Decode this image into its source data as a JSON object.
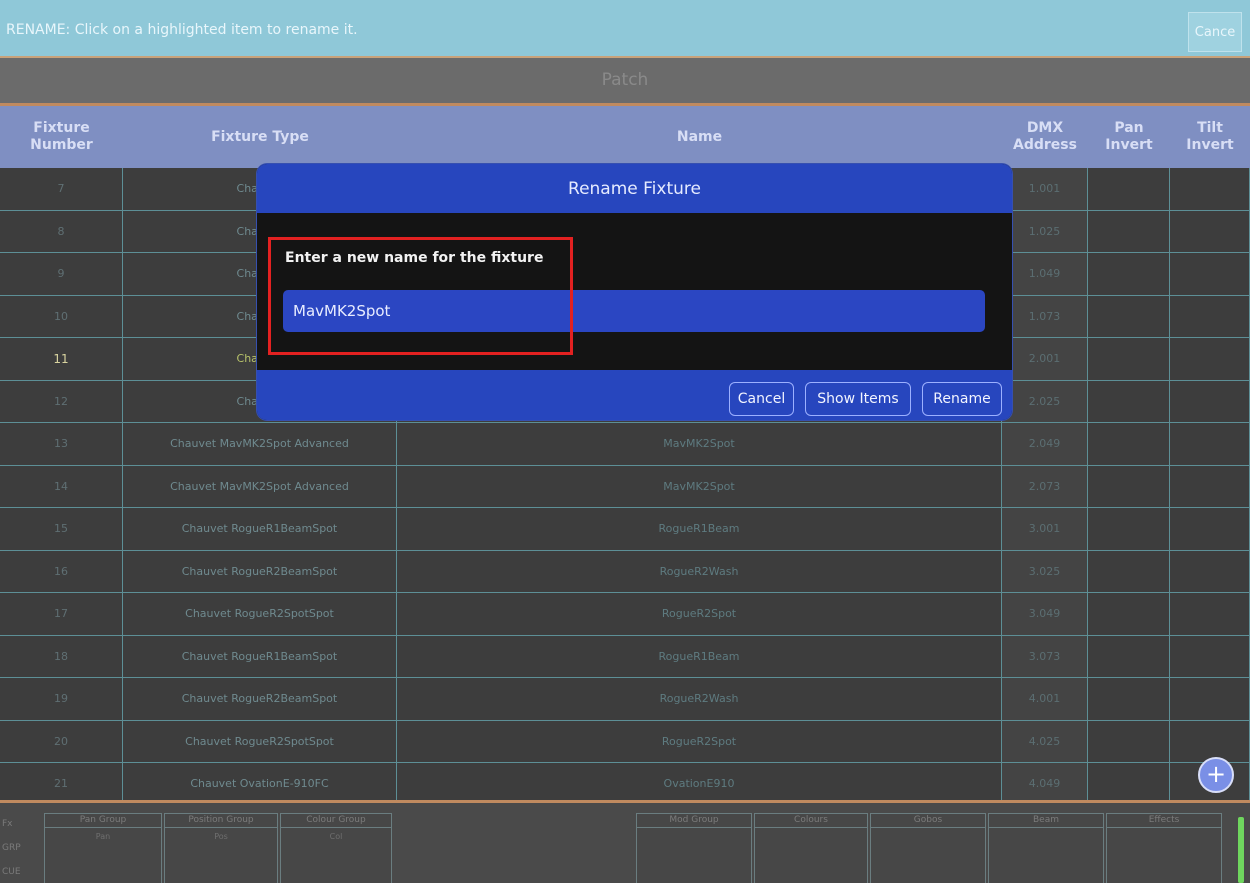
{
  "topbar": {
    "instruction": "RENAME: Click on a highlighted item to rename it.",
    "cancel_label": "Cance"
  },
  "page": {
    "title": "Patch"
  },
  "table": {
    "headers": {
      "fixture_number": "Fixture\nNumber",
      "fixture_type": "Fixture Type",
      "name": "Name",
      "dmx": "DMX\nAddress",
      "pan": "Pan\nInvert",
      "tilt": "Tilt\nInvert"
    },
    "rows": [
      {
        "num": "7",
        "type": "Chauvet",
        "name": "",
        "dmx": "1.001"
      },
      {
        "num": "8",
        "type": "Chauvet",
        "name": "",
        "dmx": "1.025"
      },
      {
        "num": "9",
        "type": "Chauvet",
        "name": "",
        "dmx": "1.049"
      },
      {
        "num": "10",
        "type": "Chauvet",
        "name": "",
        "dmx": "1.073"
      },
      {
        "num": "11",
        "type": "Chauvet",
        "name": "",
        "dmx": "2.001"
      },
      {
        "num": "12",
        "type": "Chauvet",
        "name": "",
        "dmx": "2.025"
      },
      {
        "num": "13",
        "type": "Chauvet MavMK2Spot Advanced",
        "name": "MavMK2Spot",
        "dmx": "2.049"
      },
      {
        "num": "14",
        "type": "Chauvet MavMK2Spot Advanced",
        "name": "MavMK2Spot",
        "dmx": "2.073"
      },
      {
        "num": "15",
        "type": "Chauvet RogueR1BeamSpot",
        "name": "RogueR1Beam",
        "dmx": "3.001"
      },
      {
        "num": "16",
        "type": "Chauvet RogueR2BeamSpot",
        "name": "RogueR2Wash",
        "dmx": "3.025"
      },
      {
        "num": "17",
        "type": "Chauvet RogueR2SpotSpot",
        "name": "RogueR2Spot",
        "dmx": "3.049"
      },
      {
        "num": "18",
        "type": "Chauvet RogueR1BeamSpot",
        "name": "RogueR1Beam",
        "dmx": "3.073"
      },
      {
        "num": "19",
        "type": "Chauvet RogueR2BeamSpot",
        "name": "RogueR2Wash",
        "dmx": "4.001"
      },
      {
        "num": "20",
        "type": "Chauvet RogueR2SpotSpot",
        "name": "RogueR2Spot",
        "dmx": "4.025"
      },
      {
        "num": "21",
        "type": "Chauvet OvationE-910FC",
        "name": "OvationE910",
        "dmx": "4.049"
      }
    ]
  },
  "dialog": {
    "title": "Rename Fixture",
    "prompt": "Enter a new name for the fixture",
    "input_value": "MavMK2Spot",
    "cancel_label": "Cancel",
    "show_items_label": "Show Items",
    "rename_label": "Rename"
  },
  "fab": {
    "label": "+"
  },
  "bottom": {
    "side_labels": [
      "Fx",
      "GRP",
      "CUE"
    ],
    "palettes": [
      {
        "title": "Pan Group",
        "sub": "Pan"
      },
      {
        "title": "Position Group",
        "sub": "Pos"
      },
      {
        "title": "Colour Group",
        "sub": "Col"
      },
      {
        "title": "Mod Group",
        "sub": ""
      },
      {
        "title": "Colours",
        "sub": ""
      },
      {
        "title": "Gobos",
        "sub": ""
      },
      {
        "title": "Beam",
        "sub": ""
      },
      {
        "title": "Effects",
        "sub": ""
      }
    ]
  },
  "colors": {
    "accent_blue": "#2746be",
    "highlight_red": "#e32121",
    "header_bg": "#7f8fc2"
  }
}
